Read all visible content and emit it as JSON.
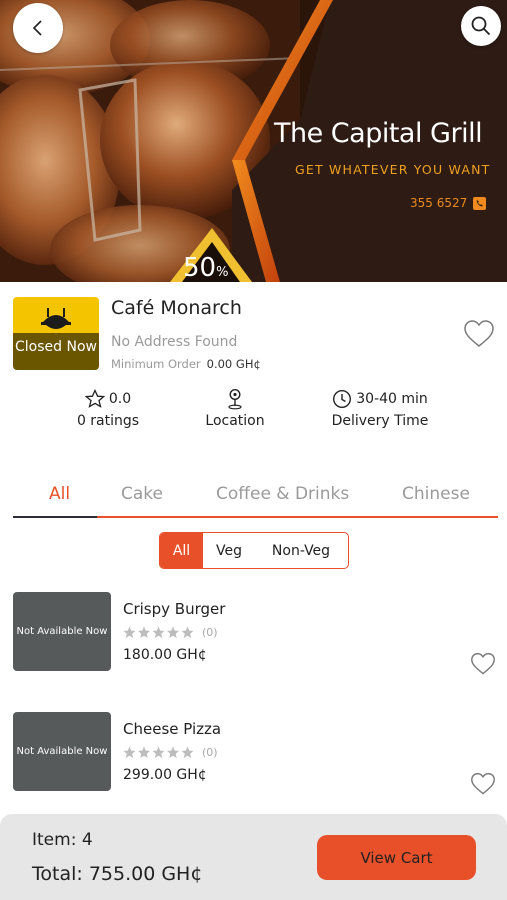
{
  "banner": {
    "title": "The Capital Grill",
    "tagline": "GET WHATEVER YOU WANT",
    "phone": "355 6527",
    "promo_value": "50",
    "promo_unit": "%"
  },
  "restaurant": {
    "name": "Café Monarch",
    "status": "Closed Now",
    "address": "No Address Found",
    "min_order_label": "Minimum Order",
    "min_order_value": "0.00 GH¢"
  },
  "stats": {
    "rating_value": "0.0",
    "rating_label": "0 ratings",
    "location_label": "Location",
    "delivery_value": "30-40 min",
    "delivery_label": "Delivery Time"
  },
  "tabs": [
    {
      "label": "All",
      "active": true
    },
    {
      "label": "Cake",
      "active": false
    },
    {
      "label": "Coffee & Drinks",
      "active": false
    },
    {
      "label": "Chinese",
      "active": false
    }
  ],
  "filter": {
    "options": [
      "All",
      "Veg",
      "Non-Veg"
    ],
    "selected": "All"
  },
  "items": [
    {
      "name": "Crispy Burger",
      "availability": "Not Available Now",
      "rating_count": "(0)",
      "rating": 0,
      "max_rating": 5,
      "price": "180.00 GH¢"
    },
    {
      "name": "Cheese Pizza",
      "availability": "Not Available Now",
      "rating_count": "(0)",
      "rating": 0,
      "max_rating": 5,
      "price": "299.00 GH¢"
    }
  ],
  "cart": {
    "item_count_text": "Item: 4",
    "total_text": "Total: 755.00 GH¢",
    "button_label": "View Cart"
  },
  "colors": {
    "accent": "#e8502a",
    "banner_tagline": "#f0a020",
    "logo_bg": "#f5c400",
    "tab_active_underline": "#2c2c3a"
  },
  "icons": [
    "back-arrow-icon",
    "search-icon",
    "phone-icon",
    "cloche-icon",
    "heart-icon",
    "star-icon",
    "location-pin-icon",
    "clock-icon"
  ]
}
